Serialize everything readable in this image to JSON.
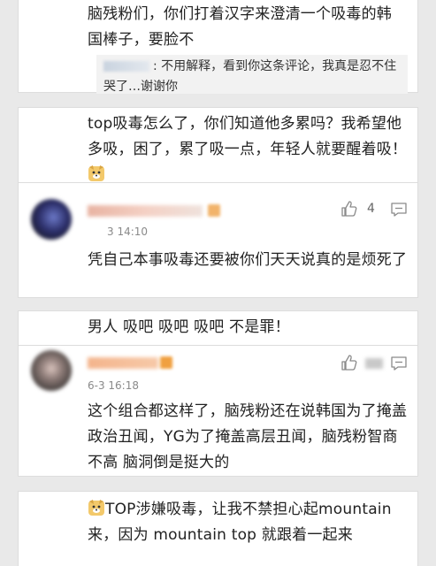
{
  "card1": {
    "text": "脑残粉们，你们打着汉字来澄清一个吸毒的韩国棒子，要脸不",
    "reply_text": ": 不用解释，看到你这条评论，我真是忍不住哭了…谢谢你"
  },
  "card2": {
    "text": "top吸毒怎么了，你们知道他多累吗？我希望他多吸，困了，累了吸一点，年轻人就要醒着吸！",
    "emoji_icon": "doge-emoji-icon"
  },
  "comment1": {
    "time": "3 14:10",
    "like_count": "4",
    "text": "凭自己本事吸毒还要被你们天天说真的是烦死了"
  },
  "card3": {
    "text": "男人 吸吧 吸吧 吸吧 不是罪！"
  },
  "comment2": {
    "time": "6-3 16:18",
    "text": "这个组合都这样了，脑残粉还在说韩国为了掩盖政治丑闻，YG为了掩盖高层丑闻，脑残粉智商不高 脑洞倒是挺大的"
  },
  "card4": {
    "text": "TOP涉嫌吸毒，让我不禁担心起mountain来，因为 mountain top 就跟着一起来"
  }
}
